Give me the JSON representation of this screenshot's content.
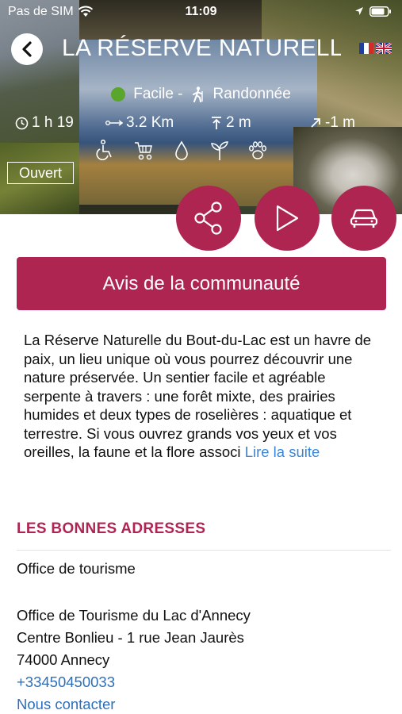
{
  "status_bar": {
    "carrier": "Pas de SIM",
    "time": "11:09"
  },
  "header": {
    "title": "LA RÉSERVE NATURELLE",
    "languages": [
      "fr",
      "en"
    ]
  },
  "route": {
    "difficulty": "Facile -",
    "activity": "Randonnée",
    "duration": "1 h 19",
    "distance": "3.2 Km",
    "ascent": "2 m",
    "descent": "-1 m",
    "amenities": [
      "wheelchair-icon",
      "stroller-icon",
      "water-drop-icon",
      "plant-icon",
      "paw-icon"
    ],
    "status_badge": "Ouvert"
  },
  "actions": {
    "share": "share-icon",
    "play": "play-icon",
    "directions": "car-icon",
    "community_button": "Avis de la communauté"
  },
  "description": {
    "text": "La Réserve Naturelle du Bout-du-Lac est un havre de paix, un lieu unique où vous pourrez découvrir une nature préservée. Un sentier facile et agréable serpente à travers : une forêt mixte, des prairies humides et deux types de roselières : aquatique et terrestre. Si vous ouvrez grands vos yeux et vos oreilles, la faune et la flore associ",
    "read_more": "Lire la suite"
  },
  "addresses": {
    "section_title": "LES BONNES ADRESSES",
    "category": "Office de tourisme",
    "name": "Office de Tourisme du Lac d'Annecy",
    "street": "Centre Bonlieu - 1 rue Jean Jaurès",
    "city": "74000 Annecy",
    "phone": "+33450450033",
    "contact": "Nous contacter"
  },
  "colors": {
    "accent": "#ad2550",
    "link": "#3a86d6",
    "easy": "#5aa52c"
  }
}
